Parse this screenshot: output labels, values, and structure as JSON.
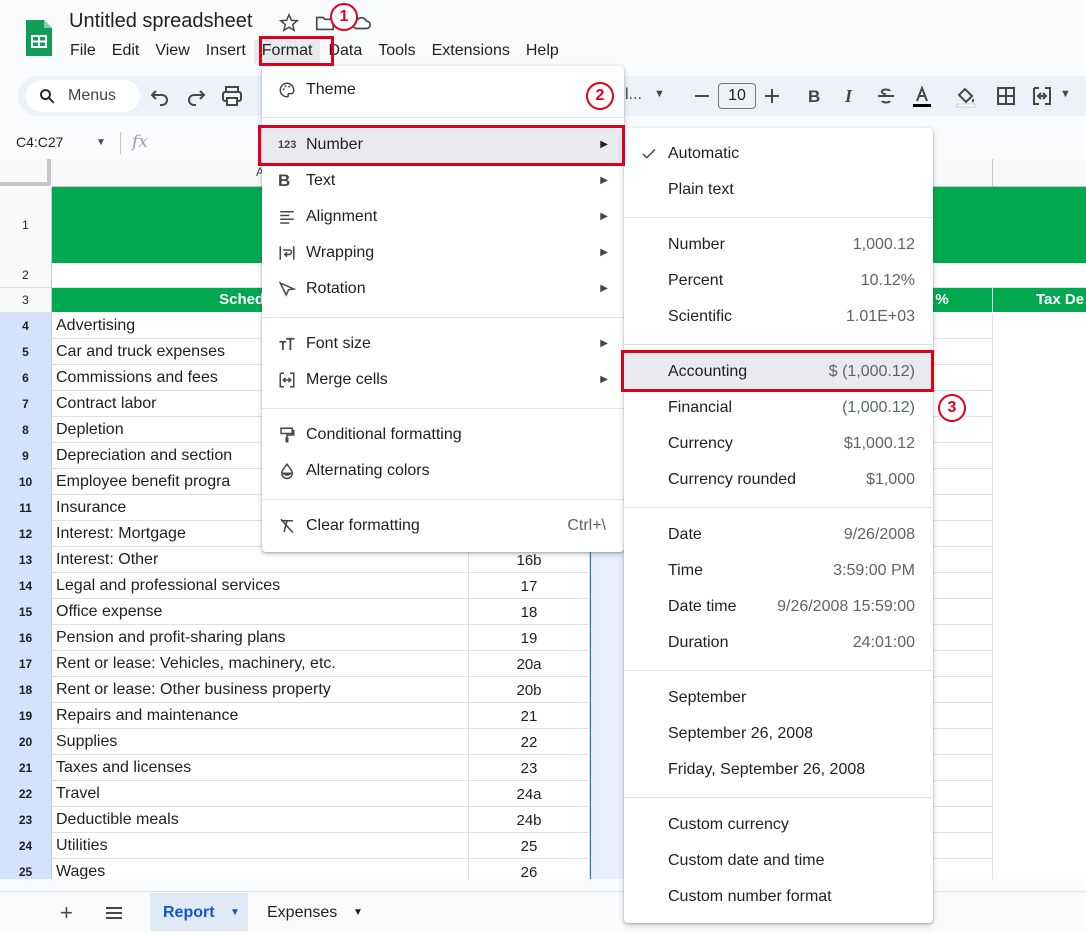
{
  "app": {
    "title": "Untitled spreadsheet",
    "menu": [
      "File",
      "Edit",
      "View",
      "Insert",
      "Format",
      "Data",
      "Tools",
      "Extensions",
      "Help"
    ]
  },
  "toolbar": {
    "menus_label": "Menus",
    "font_partial": "l...",
    "font_size": "10"
  },
  "formula_bar": {
    "name_box": "C4:C27",
    "fx": "fx"
  },
  "grid": {
    "col_a_header_partial": "A",
    "header_row": {
      "schedule": "Schedule C",
      "pct": "%",
      "tax": "Tax De"
    },
    "rows": [
      {
        "n": "1",
        "a": "",
        "b": ""
      },
      {
        "n": "2",
        "a": "",
        "b": ""
      },
      {
        "n": "3",
        "a": "",
        "b": ""
      },
      {
        "n": "4",
        "a": "Advertising",
        "b": ""
      },
      {
        "n": "5",
        "a": "Car and truck expenses",
        "b": ""
      },
      {
        "n": "6",
        "a": "Commissions and fees",
        "b": ""
      },
      {
        "n": "7",
        "a": "Contract labor",
        "b": ""
      },
      {
        "n": "8",
        "a": "Depletion",
        "b": ""
      },
      {
        "n": "9",
        "a": "Depreciation and section",
        "b": ""
      },
      {
        "n": "10",
        "a": "Employee benefit progra",
        "b": ""
      },
      {
        "n": "11",
        "a": "Insurance",
        "b": ""
      },
      {
        "n": "12",
        "a": "Interest: Mortgage",
        "b": ""
      },
      {
        "n": "13",
        "a": "Interest: Other",
        "b": "16b"
      },
      {
        "n": "14",
        "a": "Legal and professional services",
        "b": "17"
      },
      {
        "n": "15",
        "a": "Office expense",
        "b": "18"
      },
      {
        "n": "16",
        "a": "Pension and profit-sharing plans",
        "b": "19"
      },
      {
        "n": "17",
        "a": "Rent or lease: Vehicles, machinery, etc.",
        "b": "20a"
      },
      {
        "n": "18",
        "a": "Rent or lease: Other business property",
        "b": "20b"
      },
      {
        "n": "19",
        "a": "Repairs and maintenance",
        "b": "21"
      },
      {
        "n": "20",
        "a": "Supplies",
        "b": "22"
      },
      {
        "n": "21",
        "a": "Taxes and licenses",
        "b": "23"
      },
      {
        "n": "22",
        "a": "Travel",
        "b": "24a"
      },
      {
        "n": "23",
        "a": "Deductible meals",
        "b": "24b"
      },
      {
        "n": "24",
        "a": "Utilities",
        "b": "25"
      },
      {
        "n": "25",
        "a": "Wages",
        "b": "26"
      }
    ]
  },
  "format_menu": {
    "theme": "Theme",
    "number": "Number",
    "text": "Text",
    "alignment": "Alignment",
    "wrapping": "Wrapping",
    "rotation": "Rotation",
    "font_size": "Font size",
    "merge_cells": "Merge cells",
    "conditional": "Conditional formatting",
    "alternating": "Alternating colors",
    "clear": "Clear formatting",
    "clear_shortcut": "Ctrl+\\"
  },
  "number_menu": {
    "automatic": "Automatic",
    "plain_text": "Plain text",
    "number": {
      "label": "Number",
      "example": "1,000.12"
    },
    "percent": {
      "label": "Percent",
      "example": "10.12%"
    },
    "scientific": {
      "label": "Scientific",
      "example": "1.01E+03"
    },
    "accounting": {
      "label": "Accounting",
      "example": "$ (1,000.12)"
    },
    "financial": {
      "label": "Financial",
      "example": "(1,000.12)"
    },
    "currency": {
      "label": "Currency",
      "example": "$1,000.12"
    },
    "currency_rounded": {
      "label": "Currency rounded",
      "example": "$1,000"
    },
    "date": {
      "label": "Date",
      "example": "9/26/2008"
    },
    "time": {
      "label": "Time",
      "example": "3:59:00 PM"
    },
    "date_time": {
      "label": "Date time",
      "example": "9/26/2008 15:59:00"
    },
    "duration": {
      "label": "Duration",
      "example": "24:01:00"
    },
    "september": "September",
    "september_26": "September 26, 2008",
    "friday": "Friday, September 26, 2008",
    "custom_currency": "Custom currency",
    "custom_date": "Custom date and time",
    "custom_number": "Custom number format"
  },
  "callouts": [
    "1",
    "2",
    "3"
  ],
  "sheets": {
    "active": "Report",
    "other": "Expenses"
  },
  "colors": {
    "brand_green": "#00a94f",
    "selection": "#d3e3fd",
    "highlight_red": "#e0001b"
  }
}
